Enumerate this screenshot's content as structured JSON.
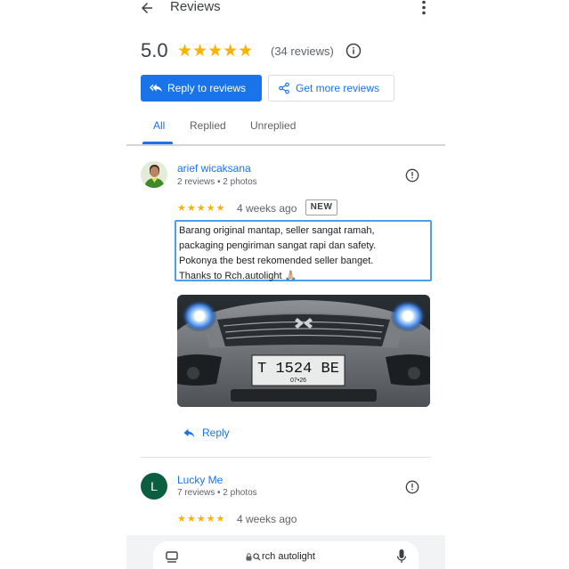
{
  "header": {
    "title": "Reviews",
    "back_icon": "arrow-back-icon",
    "more_icon": "more-vert-icon"
  },
  "summary": {
    "score": "5.0",
    "stars": "★★★★★",
    "count": "(34 reviews)",
    "info_icon": "info-icon"
  },
  "actions": {
    "reply_label": "Reply to reviews",
    "more_label": "Get more reviews"
  },
  "tabs": [
    {
      "label": "All",
      "active": true
    },
    {
      "label": "Replied",
      "active": false
    },
    {
      "label": "Unreplied",
      "active": false
    }
  ],
  "reviews": [
    {
      "name": "arief wicaksana",
      "meta": "2 reviews • 2 photos",
      "stars": "★★★★★",
      "date": "4 weeks ago",
      "badge": "NEW",
      "text_lines": [
        "Barang original mantap, seller sangat ramah,",
        "packaging pengiriman sangat rapi dan safety.",
        "Pokonya the best rekomended seller banget.",
        "Thanks to Rch.autolight 🙏🏼"
      ],
      "photo": {
        "plate": "T  1524  BE",
        "plate_sub": "07•26"
      },
      "reply_label": "Reply"
    },
    {
      "name": "Lucky Me",
      "initial": "L",
      "meta": "7 reviews • 2 photos",
      "stars": "★★★★★",
      "date": "4 weeks ago"
    }
  ],
  "browser": {
    "url": "rch autolight"
  },
  "colors": {
    "accent": "#1a73e8",
    "star": "#f9b200",
    "avatar_l": "#0b5e3f"
  }
}
